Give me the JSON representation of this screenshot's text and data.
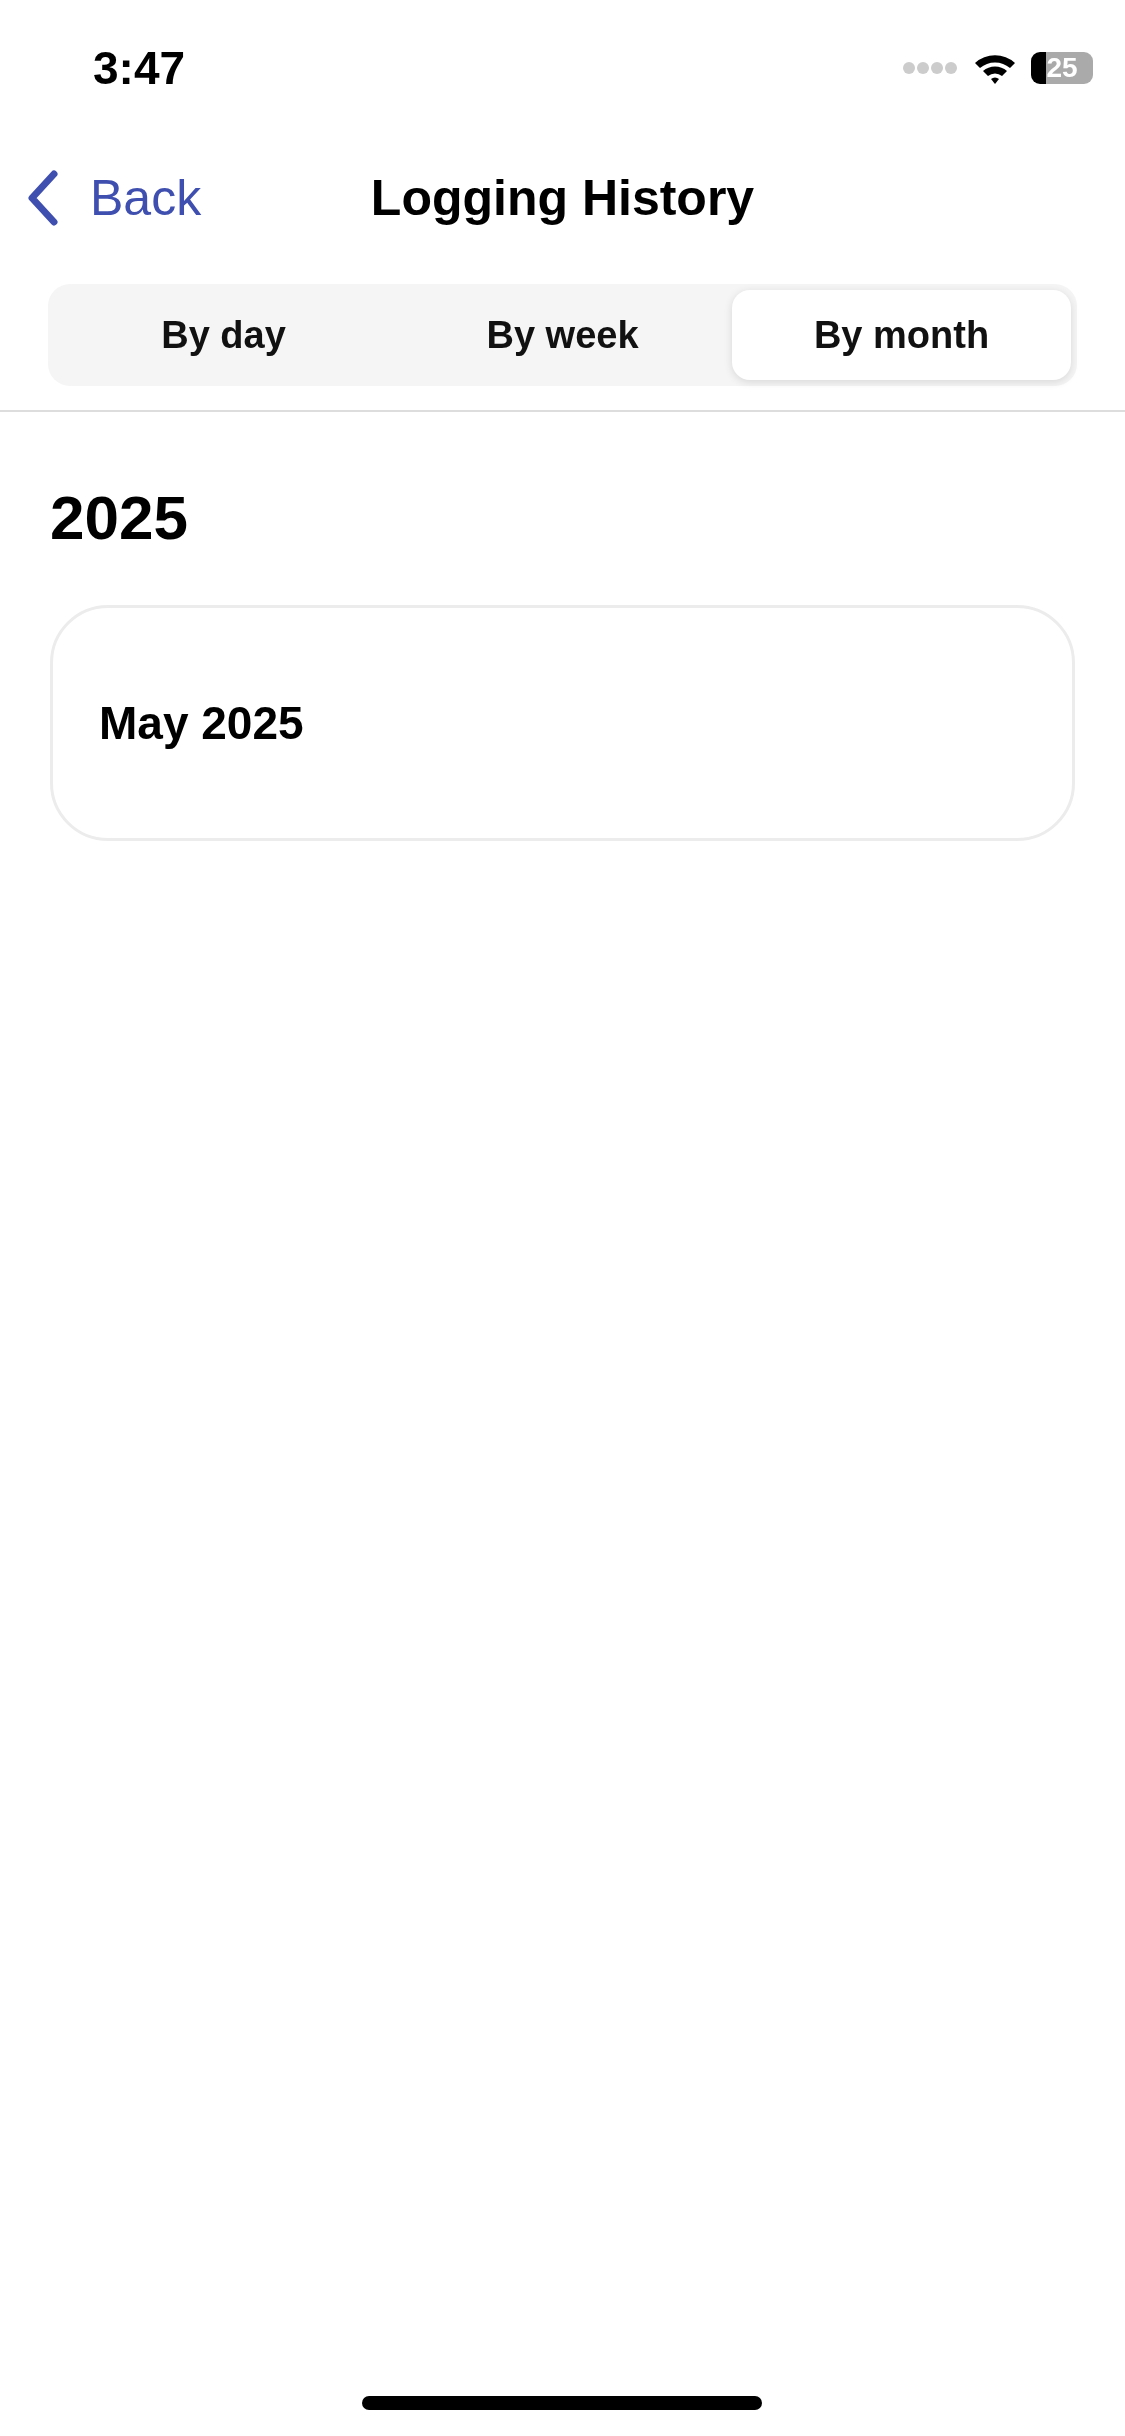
{
  "status_bar": {
    "time": "3:47",
    "battery": "25"
  },
  "nav": {
    "back": "Back",
    "title": "Logging History"
  },
  "tabs": [
    {
      "label": "By day",
      "selected": false
    },
    {
      "label": "By week",
      "selected": false
    },
    {
      "label": "By month",
      "selected": true
    }
  ],
  "sections": [
    {
      "heading": "2025",
      "items": [
        {
          "label": "May 2025"
        }
      ]
    }
  ]
}
